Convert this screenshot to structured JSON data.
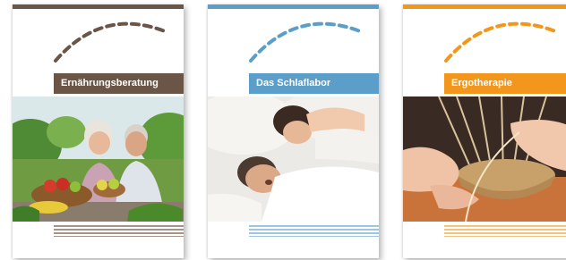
{
  "brochures": [
    {
      "title": "Ernährungsberatung",
      "accent": "#6b5546",
      "stripe": "#a59487"
    },
    {
      "title": "Das Schlaflabor",
      "accent": "#5b9ec9",
      "stripe": "#9ec6e0"
    },
    {
      "title": "Ergotherapie",
      "accent": "#f2971c",
      "stripe": "#f6c37e"
    }
  ]
}
